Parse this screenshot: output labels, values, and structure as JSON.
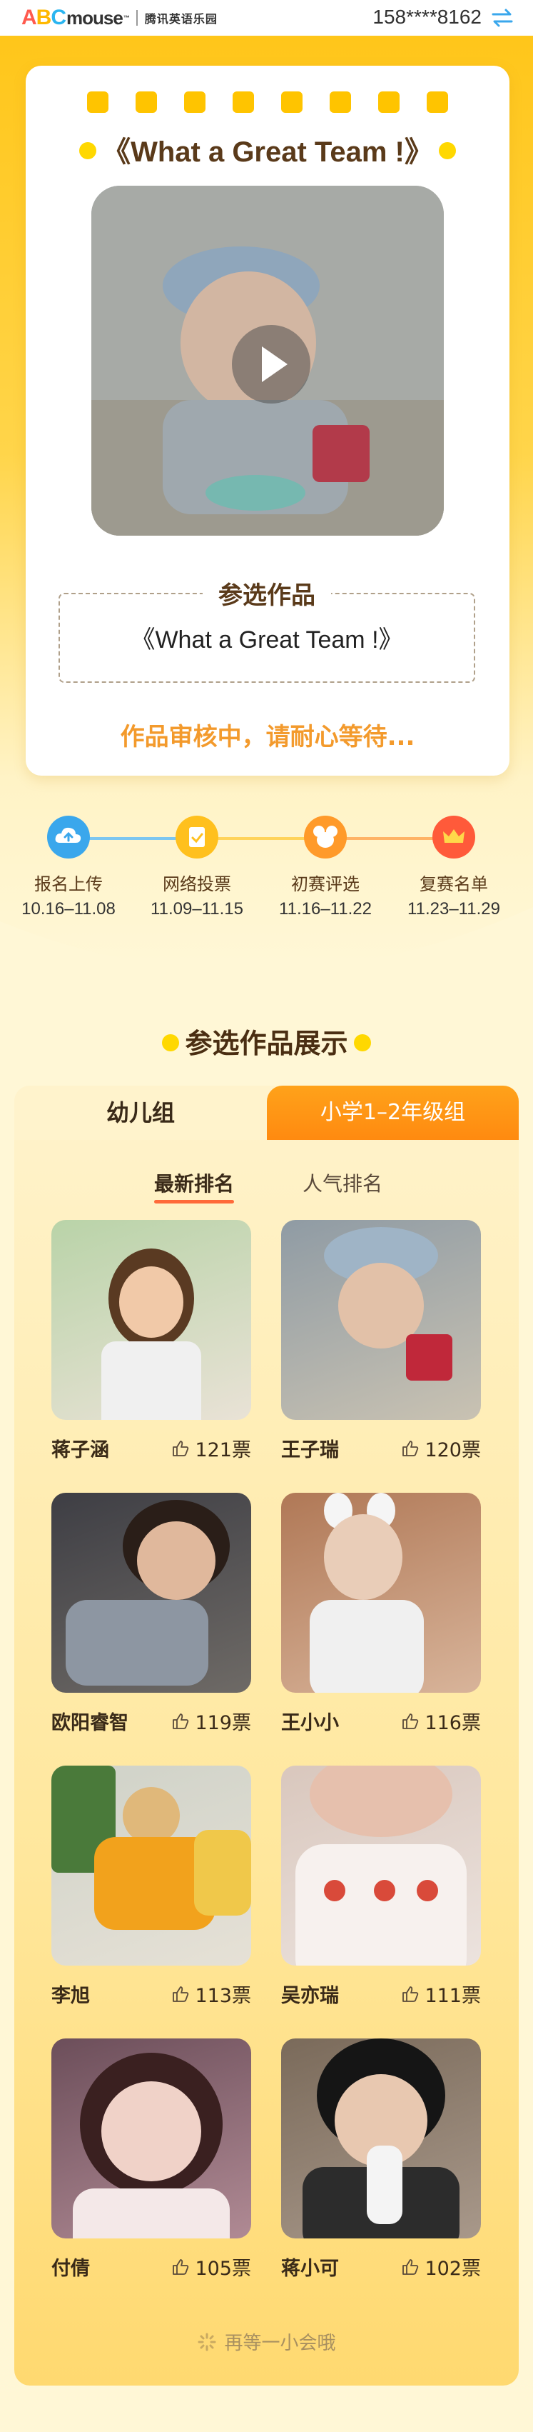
{
  "header": {
    "logo_a": "A",
    "logo_b": "B",
    "logo_c": "C",
    "logo_rest": "mouse",
    "logo_tm": "™",
    "logo_cn": "腾讯英语乐园",
    "phone": "158****8162",
    "switch_icon": "swap-arrows-icon"
  },
  "card": {
    "title": "《What a Great Team !》",
    "video_icon": "play-icon",
    "entry_label": "参选作品",
    "entry_name": "《What a Great Team !》",
    "review_status": "作品审核中，请耐心等待..."
  },
  "timeline": [
    {
      "label": "报名上传",
      "date": "10.16–11.08",
      "icon": "upload-cloud-icon",
      "color": "#3aa7ec"
    },
    {
      "label": "网络投票",
      "date": "11.09–11.15",
      "icon": "vote-check-icon",
      "color": "#ffc01e"
    },
    {
      "label": "初赛评选",
      "date": "11.16–11.22",
      "icon": "mouse-head-icon",
      "color": "#ff9a2a"
    },
    {
      "label": "复赛名单",
      "date": "11.23–11.29",
      "icon": "crown-icon",
      "color": "#ff5a3a"
    }
  ],
  "showcase": {
    "title": "参选作品展示",
    "tabs": [
      "幼儿组",
      "小学1–2年级组"
    ],
    "active_tab": "幼儿组",
    "sort_tabs": [
      "最新排名",
      "人气排名"
    ],
    "active_sort": "最新排名",
    "loading_text": "再等一小会哦",
    "items": [
      {
        "name": "蒋子涵",
        "votes": "121票"
      },
      {
        "name": "王子瑞",
        "votes": "120票"
      },
      {
        "name": "欧阳睿智",
        "votes": "119票"
      },
      {
        "name": "王小小",
        "votes": "116票"
      },
      {
        "name": "李旭",
        "votes": "113票"
      },
      {
        "name": "吴亦瑞",
        "votes": "111票"
      },
      {
        "name": "付倩",
        "votes": "105票"
      },
      {
        "name": "蒋小可",
        "votes": "102票"
      }
    ]
  },
  "colors": {
    "brand_yellow": "#ffc61a",
    "accent_orange": "#ff8a10",
    "status_orange": "#f39a2c"
  }
}
